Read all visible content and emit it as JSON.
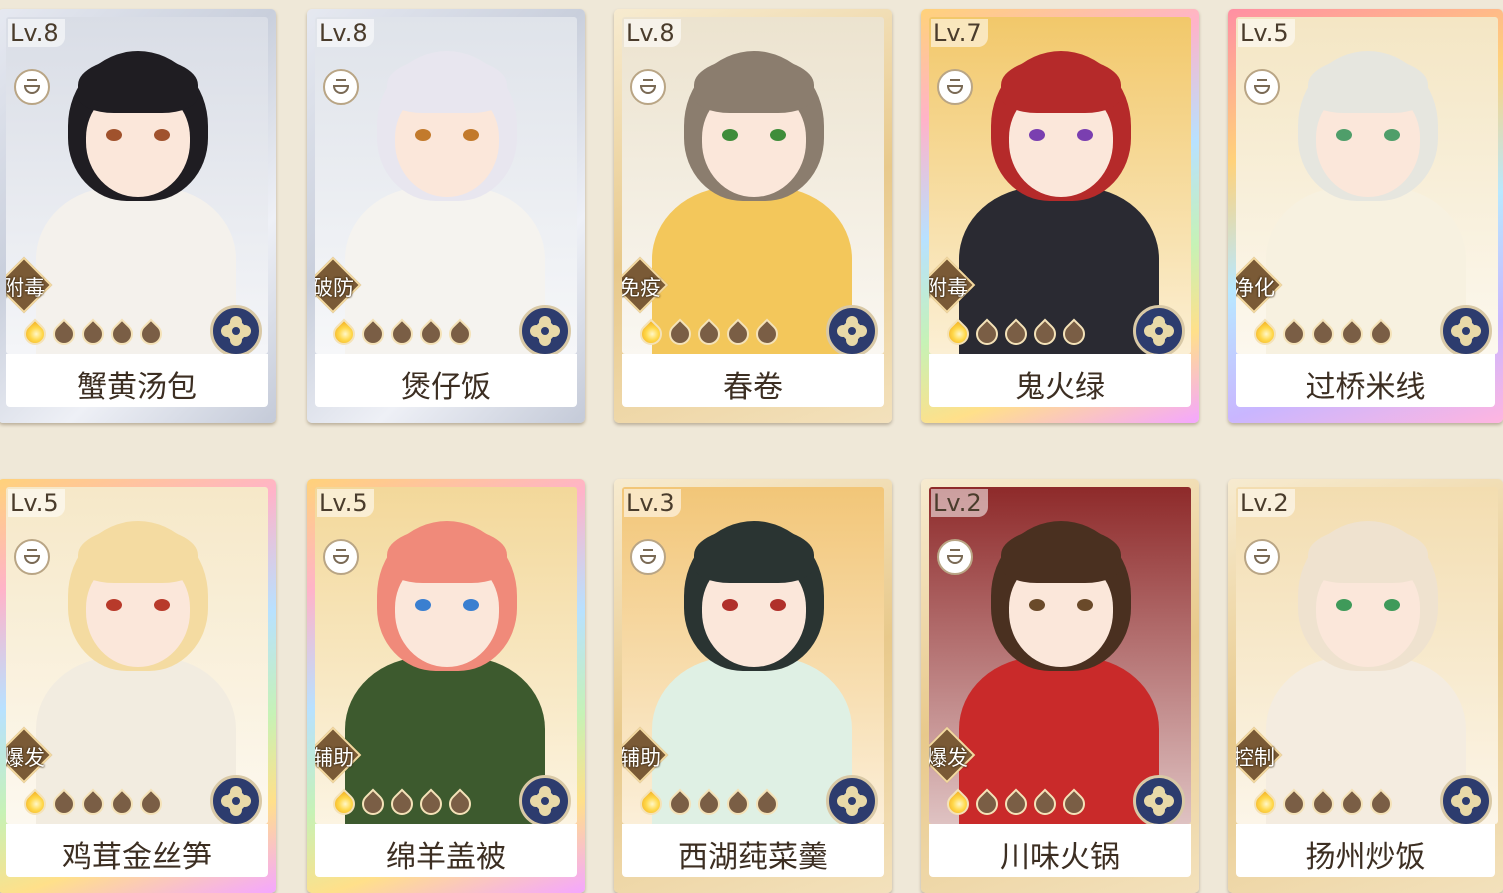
{
  "cards": [
    {
      "level": "Lv.8",
      "tag": "附毒",
      "name": "蟹黄汤包",
      "flames_lit": 1,
      "flames_total": 5,
      "rarity": "silver",
      "bg": "#d9dde6",
      "hair": "#1f1d22",
      "outfit": "#f4f1ec",
      "eye": "#a0522d"
    },
    {
      "level": "Lv.8",
      "tag": "破防",
      "name": "煲仔饭",
      "flames_lit": 1,
      "flames_total": 5,
      "rarity": "silver",
      "bg": "#dfe3ea",
      "hair": "#e8e6ef",
      "outfit": "#f5f3ef",
      "eye": "#c27a2c"
    },
    {
      "level": "Lv.8",
      "tag": "免疫",
      "name": "春卷",
      "flames_lit": 1,
      "flames_total": 5,
      "rarity": "gold",
      "bg": "#ece3cf",
      "hair": "#8b7d6e",
      "outfit": "#f3c75b",
      "eye": "#3f8d3a"
    },
    {
      "level": "Lv.7",
      "tag": "附毒",
      "name": "鬼火绿",
      "flames_lit": 1,
      "flames_total": 5,
      "rarity": "rainbow",
      "bg": "#f2c86a",
      "hair": "#b52a2a",
      "outfit": "#2a2a32",
      "eye": "#7a3fb0"
    },
    {
      "level": "Lv.5",
      "tag": "净化",
      "name": "过桥米线",
      "flames_lit": 1,
      "flames_total": 5,
      "rarity": "pink",
      "bg": "#f4e6c4",
      "hair": "#e6e6df",
      "outfit": "#f7f1e0",
      "eye": "#4f9e6a"
    },
    {
      "level": "Lv.5",
      "tag": "爆发",
      "name": "鸡茸金丝笋",
      "flames_lit": 1,
      "flames_total": 5,
      "rarity": "rainbow",
      "bg": "#f6e8c8",
      "hair": "#f4dba1",
      "outfit": "#f2ece0",
      "eye": "#b83a2a"
    },
    {
      "level": "Lv.5",
      "tag": "辅助",
      "name": "绵羊盖被",
      "flames_lit": 1,
      "flames_total": 5,
      "rarity": "rainbow",
      "bg": "#f3d89a",
      "hair": "#f08a7a",
      "outfit": "#3d5a2e",
      "eye": "#3a7fd0"
    },
    {
      "level": "Lv.3",
      "tag": "辅助",
      "name": "西湖莼菜羹",
      "flames_lit": 1,
      "flames_total": 5,
      "rarity": "gold",
      "bg": "#f2c678",
      "hair": "#2a3432",
      "outfit": "#dff0e4",
      "eye": "#b0302a"
    },
    {
      "level": "Lv.2",
      "tag": "爆发",
      "name": "川味火锅",
      "flames_lit": 1,
      "flames_total": 5,
      "rarity": "gold",
      "bg": "#8e2a2a",
      "hair": "#4a3020",
      "outfit": "#c92a2a",
      "eye": "#6a4a2a"
    },
    {
      "level": "Lv.2",
      "tag": "控制",
      "name": "扬州炒饭",
      "flames_lit": 1,
      "flames_total": 5,
      "rarity": "gold",
      "bg": "#f3ddb0",
      "hair": "#efe2cf",
      "outfit": "#f4ece0",
      "eye": "#3f9a5a"
    }
  ]
}
